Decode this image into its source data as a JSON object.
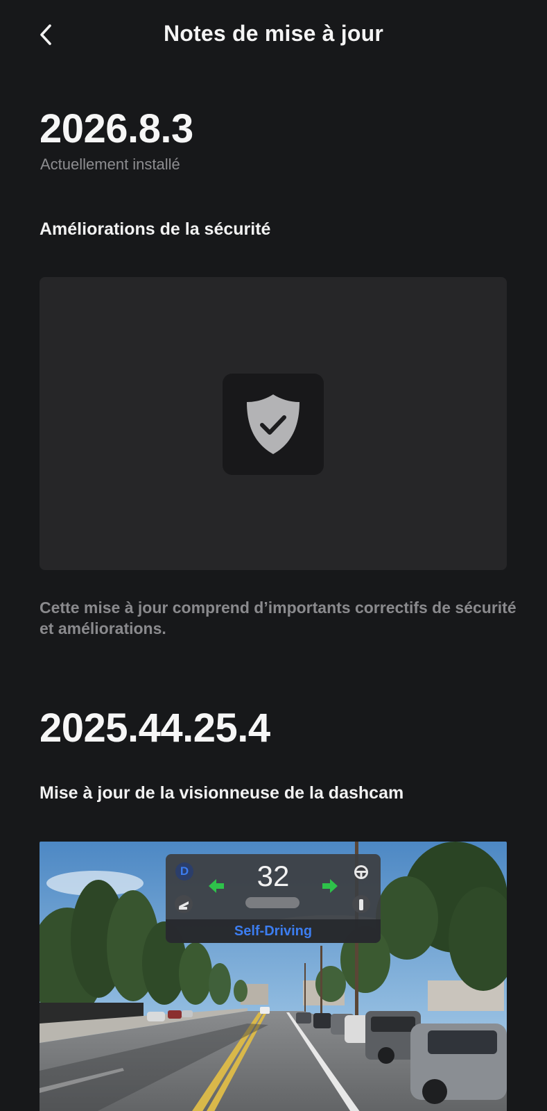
{
  "header": {
    "title": "Notes de mise à jour",
    "back_icon": "chevron-left-icon"
  },
  "releases": [
    {
      "version": "2026.8.3",
      "status": "Actuellement installé",
      "section_title": "Améliorations de la sécurité",
      "illustration_icon": "shield-check-icon",
      "description": "Cette mise à jour comprend d’importants correctifs de sécurité et améliorations."
    },
    {
      "version": "2025.44.25.4",
      "section_title": "Mise à jour de la visionneuse de la dashcam",
      "dashcam_overlay": {
        "gear": "D",
        "speed": "32",
        "mode_label": "Self-Driving",
        "left_indicator_icon": "turn-left-arrow-icon",
        "right_indicator_icon": "turn-right-arrow-icon",
        "steering_icon": "steering-wheel-icon",
        "brake_pedal_icon": "brake-pedal-icon",
        "accelerator_pedal_icon": "accelerator-pedal-icon"
      }
    }
  ],
  "colors": {
    "background": "#17181a",
    "card": "#262628",
    "muted_text": "#8a8a8d",
    "accent_blue": "#3c7df0",
    "indicator_green": "#2ec24a"
  }
}
